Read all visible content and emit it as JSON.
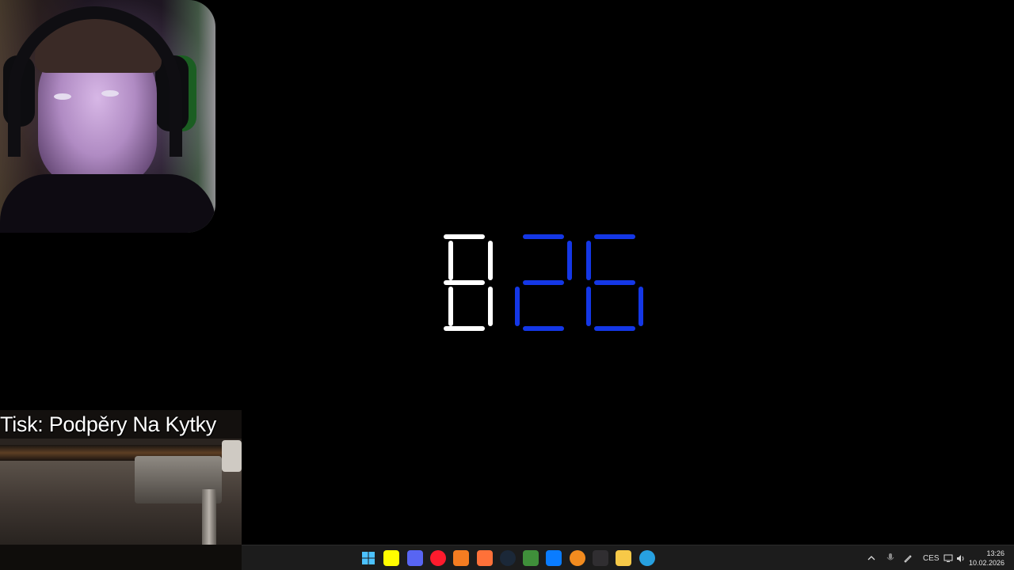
{
  "clock": {
    "hours": "13",
    "minutes": "26",
    "hours_color": "#ffffff",
    "minutes_color": "#1437e6"
  },
  "printer_overlay": {
    "title": "Tisk: Podpěry Na Kytky"
  },
  "taskbar": {
    "apps": [
      {
        "name": "start-icon",
        "color": "#2ea6ff"
      },
      {
        "name": "snapchat-icon",
        "color": "#fffc00"
      },
      {
        "name": "discord-icon",
        "color": "#5865f2"
      },
      {
        "name": "opera-icon",
        "color": "#ff1b2d"
      },
      {
        "name": "aseprite-icon",
        "color": "#f47c21"
      },
      {
        "name": "firefox-icon",
        "color": "#ff7139"
      },
      {
        "name": "steam-icon",
        "color": "#1b2838"
      },
      {
        "name": "minecraft-launcher-icon",
        "color": "#3f8f3a"
      },
      {
        "name": "messenger-icon",
        "color": "#0a7cff"
      },
      {
        "name": "fl-studio-icon",
        "color": "#f28b1f"
      },
      {
        "name": "obs-icon",
        "color": "#302e31"
      },
      {
        "name": "file-explorer-icon",
        "color": "#f7c948"
      },
      {
        "name": "paint-icon",
        "color": "#27a0e0"
      }
    ],
    "tray": {
      "language": "CES",
      "time": "13:26",
      "date": "10.02.2026"
    }
  }
}
